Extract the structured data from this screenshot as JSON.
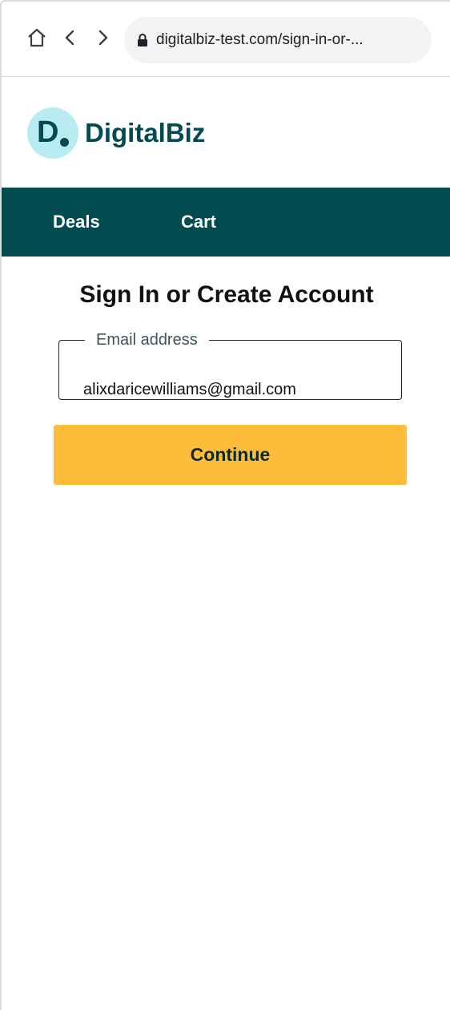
{
  "browser": {
    "url": "digitalbiz-test.com/sign-in-or-..."
  },
  "brand": {
    "logo_letter": "D",
    "name": "DigitalBiz",
    "primary_color": "#024b4f",
    "logo_bg_color": "#b9ecf1"
  },
  "nav": {
    "items": [
      {
        "label": "Deals"
      },
      {
        "label": "Cart"
      }
    ]
  },
  "form": {
    "title": "Sign In or Create Account",
    "email_label": "Email address",
    "email_value": "alixdaricewilliams@gmail.com",
    "continue_label": "Continue",
    "button_color": "#febd38"
  },
  "icons": {
    "home": "home-icon",
    "back": "chevron-left-icon",
    "forward": "chevron-right-icon",
    "lock": "lock-icon"
  }
}
